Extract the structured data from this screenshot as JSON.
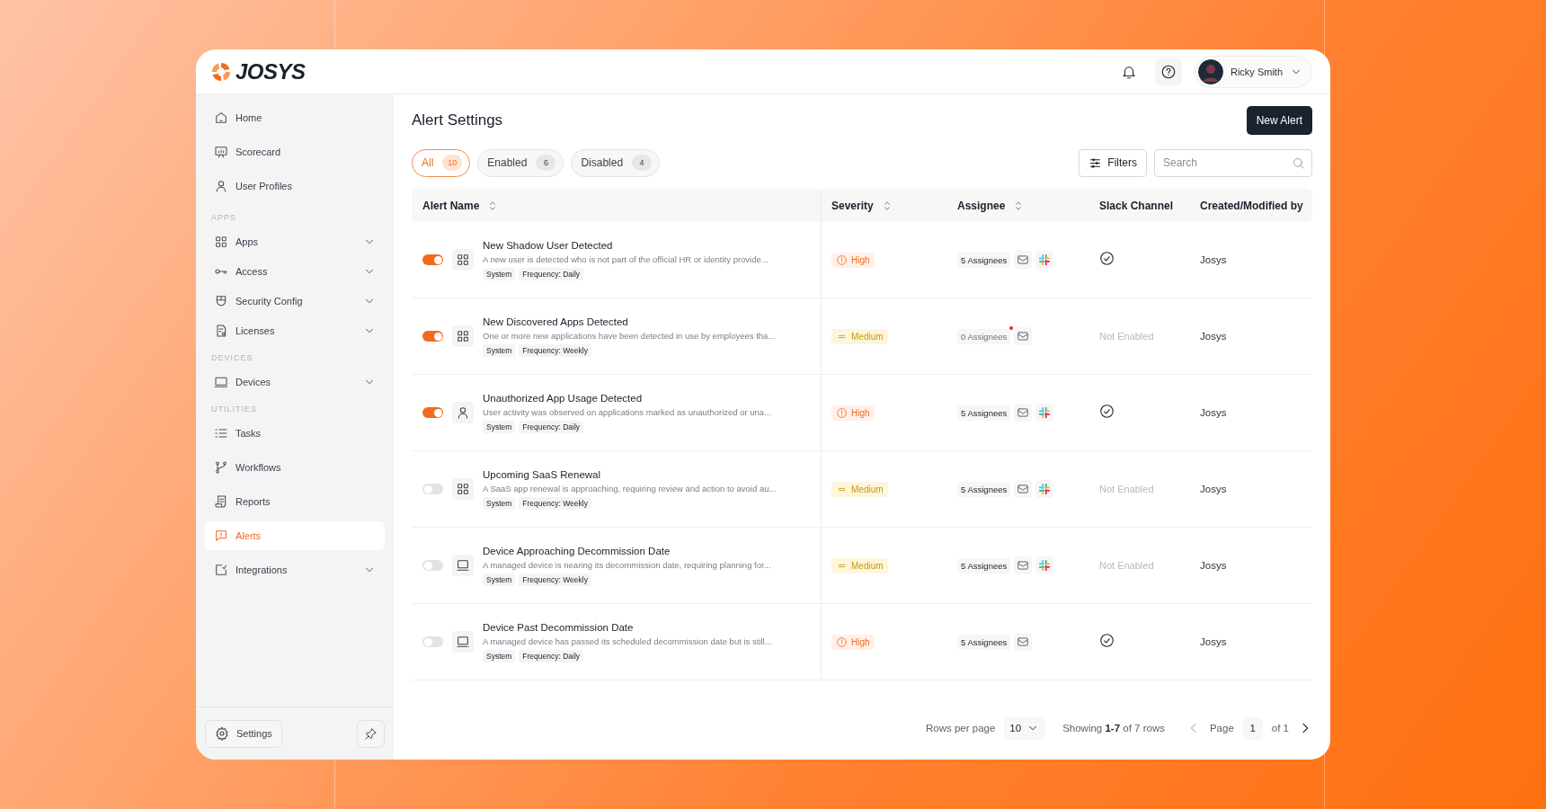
{
  "brand": {
    "name": "JOSYS"
  },
  "header": {
    "user_name": "Ricky Smith"
  },
  "sidebar": {
    "items": [
      {
        "kind": "item",
        "label": "Home",
        "selected": false
      },
      {
        "kind": "item",
        "label": "Scorecard",
        "selected": false
      },
      {
        "kind": "item",
        "label": "User Profiles",
        "selected": false
      },
      {
        "kind": "heading",
        "label": "APPS"
      },
      {
        "kind": "item",
        "label": "Apps",
        "selected": false,
        "expanded": false
      },
      {
        "kind": "item",
        "label": "Access",
        "selected": false,
        "expanded": false
      },
      {
        "kind": "item",
        "label": "Security Config",
        "selected": false,
        "expanded": false
      },
      {
        "kind": "item",
        "label": "Licenses",
        "selected": false,
        "expanded": false
      },
      {
        "kind": "heading",
        "label": "DEVICES"
      },
      {
        "kind": "item",
        "label": "Devices",
        "selected": false,
        "expanded": false
      },
      {
        "kind": "heading",
        "label": "UTILITIES"
      },
      {
        "kind": "item",
        "label": "Tasks",
        "selected": false
      },
      {
        "kind": "item",
        "label": "Workflows",
        "selected": false
      },
      {
        "kind": "item",
        "label": "Reports",
        "selected": false
      },
      {
        "kind": "item",
        "label": "Alerts",
        "selected": true
      },
      {
        "kind": "item",
        "label": "Integrations",
        "selected": false,
        "expanded": false
      }
    ],
    "settings_label": "Settings"
  },
  "page": {
    "title": "Alert Settings",
    "new_button": "New Alert",
    "filters_button": "Filters",
    "search": {
      "placeholder": "Search"
    }
  },
  "tabs": [
    {
      "label": "All",
      "count": "10",
      "selected": true
    },
    {
      "label": "Enabled",
      "count": "6",
      "selected": false
    },
    {
      "label": "Disabled",
      "count": "4",
      "selected": false
    }
  ],
  "table": {
    "columns": [
      {
        "label": "Alert Name",
        "sortable": true
      },
      {
        "label": "Severity",
        "sortable": true
      },
      {
        "label": "Assignee",
        "sortable": true
      },
      {
        "label": "Slack Channel",
        "sortable": false
      },
      {
        "label": "Created/Modified by",
        "sortable": false
      }
    ],
    "rows": [
      {
        "enabled": true,
        "kind": "app",
        "title": "New Shadow User Detected",
        "description": "A new user is detected who is not part of the official HR or identity provide...",
        "tags": [
          "System",
          "Frequency: Daily"
        ],
        "severity": {
          "kind": "high",
          "label": "High"
        },
        "assignees": "5 Assignees",
        "assignee_alert": false,
        "slack": true,
        "slack_channel": {
          "enabled": true
        },
        "created_by": "Josys"
      },
      {
        "enabled": true,
        "kind": "app",
        "title": "New Discovered Apps Detected",
        "description": "One or more new applications have been detected in use by employees tha...",
        "tags": [
          "System",
          "Frequency: Weekly"
        ],
        "severity": {
          "kind": "medium",
          "label": "Medium"
        },
        "assignees": "0 Assignees",
        "assignee_alert": true,
        "slack": false,
        "slack_channel": {
          "enabled": false,
          "label": "Not Enabled"
        },
        "created_by": "Josys"
      },
      {
        "enabled": true,
        "kind": "user",
        "title": "Unauthorized App Usage Detected",
        "description": "User activity was observed on applications marked as unauthorized or una...",
        "tags": [
          "System",
          "Frequency: Daily"
        ],
        "severity": {
          "kind": "high",
          "label": "High"
        },
        "assignees": "5 Assignees",
        "assignee_alert": false,
        "slack": true,
        "slack_channel": {
          "enabled": true
        },
        "created_by": "Josys"
      },
      {
        "enabled": false,
        "kind": "app",
        "title": "Upcoming SaaS Renewal",
        "description": "A SaaS app renewal is approaching, requiring review and action to avoid au...",
        "tags": [
          "System",
          "Frequency: Weekly"
        ],
        "severity": {
          "kind": "medium",
          "label": "Medium"
        },
        "assignees": "5 Assignees",
        "assignee_alert": false,
        "slack": true,
        "slack_channel": {
          "enabled": false,
          "label": "Not Enabled"
        },
        "created_by": "Josys"
      },
      {
        "enabled": false,
        "kind": "device",
        "title": "Device Approaching Decommission Date",
        "description": "A managed device is nearing its decommission date, requiring planning for...",
        "tags": [
          "System",
          "Frequency: Weekly"
        ],
        "severity": {
          "kind": "medium",
          "label": "Medium"
        },
        "assignees": "5 Assignees",
        "assignee_alert": false,
        "slack": true,
        "slack_channel": {
          "enabled": false,
          "label": "Not Enabled"
        },
        "created_by": "Josys"
      },
      {
        "enabled": false,
        "kind": "device",
        "title": "Device Past Decommission Date",
        "description": "A managed device has passed its scheduled decommission date but is still...",
        "tags": [
          "System",
          "Frequency: Daily"
        ],
        "severity": {
          "kind": "high",
          "label": "High"
        },
        "assignees": "5 Assignees",
        "assignee_alert": false,
        "slack": false,
        "slack_channel": {
          "enabled": true
        },
        "created_by": "Josys"
      }
    ]
  },
  "pagination": {
    "rows_per_page_label": "Rows per page",
    "rows_per_page": "10",
    "showing": "Showing **1-7** of 7 rows",
    "page_label": "Page",
    "page": "1",
    "page_total": "of 1"
  }
}
